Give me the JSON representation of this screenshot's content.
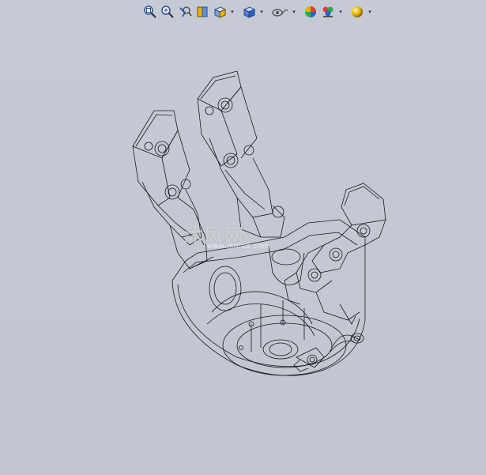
{
  "toolbar": {
    "tools": [
      {
        "name": "zoom-to-fit-icon",
        "dropdown": false
      },
      {
        "name": "zoom-to-area-icon",
        "dropdown": false
      },
      {
        "name": "previous-view-icon",
        "dropdown": false
      },
      {
        "name": "section-view-icon",
        "dropdown": false
      },
      {
        "name": "view-orientation-icon",
        "dropdown": true
      },
      {
        "name": "display-style-icon",
        "dropdown": true
      },
      {
        "name": "hide-show-items-icon",
        "dropdown": true
      },
      {
        "name": "edit-appearance-icon",
        "dropdown": false
      },
      {
        "name": "apply-scene-icon",
        "dropdown": true
      },
      {
        "name": "view-settings-icon",
        "dropdown": true
      }
    ],
    "caret_glyph": "▾"
  },
  "viewport": {
    "background": "#c4c8d3",
    "render_style": "wireframe",
    "model": "robotic-hand-gripper"
  },
  "watermark": {
    "text": "沐风网",
    "sub": "www.mfcad.com"
  },
  "colors": {
    "wire": "#1a1a1a",
    "accent_blue": "#2a62c9",
    "accent_yellow": "#e9b400"
  }
}
